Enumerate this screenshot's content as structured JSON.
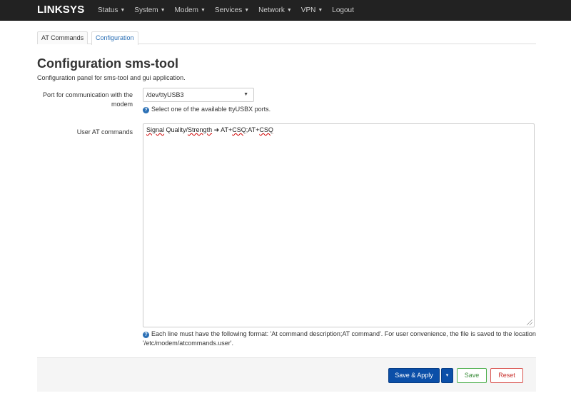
{
  "navbar": {
    "brand": "LINKSYS",
    "items": [
      {
        "label": "Status",
        "caret": "▼"
      },
      {
        "label": "System",
        "caret": "▼"
      },
      {
        "label": "Modem",
        "caret": "▼"
      },
      {
        "label": "Services",
        "caret": "▼"
      },
      {
        "label": "Network",
        "caret": "▼"
      },
      {
        "label": "VPN",
        "caret": "▼"
      },
      {
        "label": "Logout",
        "caret": ""
      }
    ]
  },
  "tabs": [
    {
      "label": "AT Commands",
      "active": false
    },
    {
      "label": "Configuration",
      "active": true
    }
  ],
  "page": {
    "title": "Configuration sms-tool",
    "description": "Configuration panel for sms-tool and gui application."
  },
  "port": {
    "label": "Port for communication with the modem",
    "value": "/dev/ttyUSB3",
    "help": "Select one of the available ttyUSBX ports."
  },
  "commands": {
    "label": "User AT commands",
    "line_parts": [
      "Signal",
      " Quality/",
      "Strength",
      " ➜ AT+",
      "CSQ",
      ";AT+",
      "CSQ"
    ],
    "help": "Each line must have the following format: 'At command description;AT command'. For user convenience, the file is saved to the location '/etc/modem/atcommands.user'."
  },
  "actions": {
    "save_apply": "Save & Apply",
    "dropdown": "▾",
    "save": "Save",
    "reset": "Reset"
  },
  "icons": {
    "help": "question-circle-icon",
    "help_glyph": "?"
  },
  "colors": {
    "navbar_bg": "#222222",
    "primary": "#0b4fa8",
    "save": "#4cae4c",
    "reset": "#d9534f",
    "link": "#2a6fb5"
  }
}
